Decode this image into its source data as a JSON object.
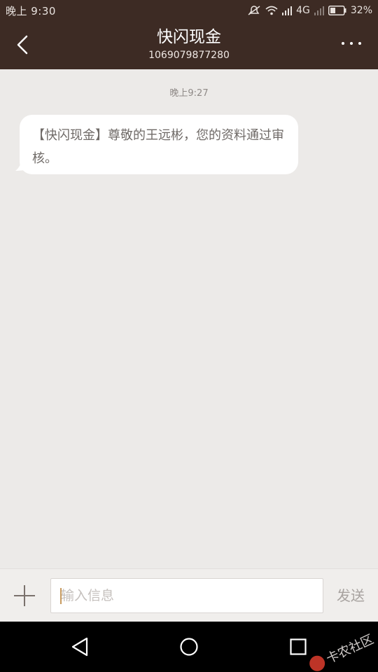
{
  "status_bar": {
    "time": "晚上 9:30",
    "network": "4G",
    "battery": "32%"
  },
  "header": {
    "title": "快闪现金",
    "subtitle": "1069079877280"
  },
  "messages": {
    "timestamp": "晚上9:27",
    "items": [
      {
        "text": "【快闪现金】尊敬的王远彬，您的资料通过审核。"
      }
    ]
  },
  "input_bar": {
    "placeholder": "输入信息",
    "send_label": "发送"
  },
  "watermark": {
    "text": "卡农社区"
  },
  "icons": {
    "back": "chevron-left-icon",
    "more": "more-dots-icon",
    "plus": "plus-icon",
    "nav_back": "triangle-back-icon",
    "nav_home": "circle-home-icon",
    "nav_recent": "square-recent-icon"
  },
  "colors": {
    "header_bg": "#3d2b24",
    "page_bg": "#eceae8",
    "bubble_bg": "#ffffff",
    "caret": "#c79a5e"
  }
}
